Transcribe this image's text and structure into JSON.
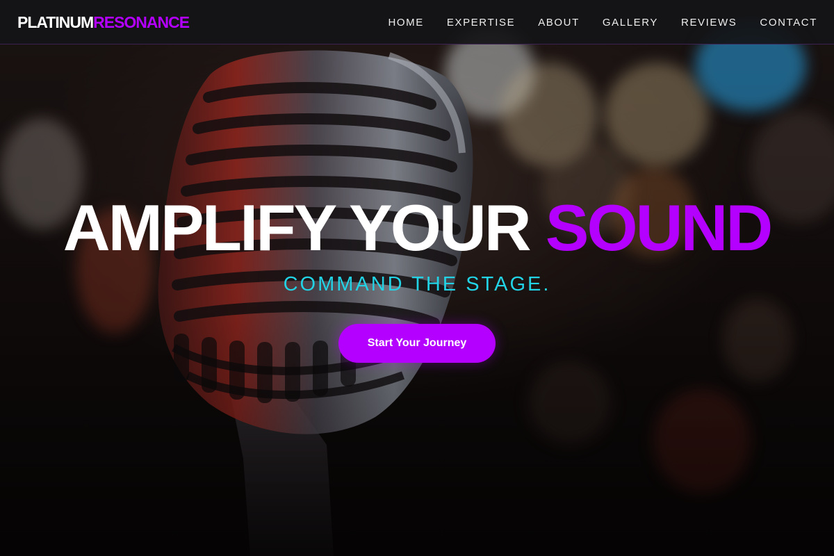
{
  "header": {
    "logo": {
      "part1": "PLATINUM",
      "part2": "RESONANCE"
    },
    "nav": [
      {
        "label": "HOME"
      },
      {
        "label": "EXPERTISE"
      },
      {
        "label": "ABOUT"
      },
      {
        "label": "GALLERY"
      },
      {
        "label": "REVIEWS"
      },
      {
        "label": "CONTACT"
      }
    ]
  },
  "hero": {
    "headline_main": "AMPLIFY YOUR",
    "headline_accent": "SOUND",
    "subheadline": "COMMAND THE STAGE.",
    "cta_label": "Start Your Journey"
  },
  "colors": {
    "accent": "#b300ff",
    "subheadline": "#22d3e6",
    "header_bg": "#141416",
    "text": "#ffffff"
  },
  "icons": [
    "vintage-microphone-image"
  ]
}
